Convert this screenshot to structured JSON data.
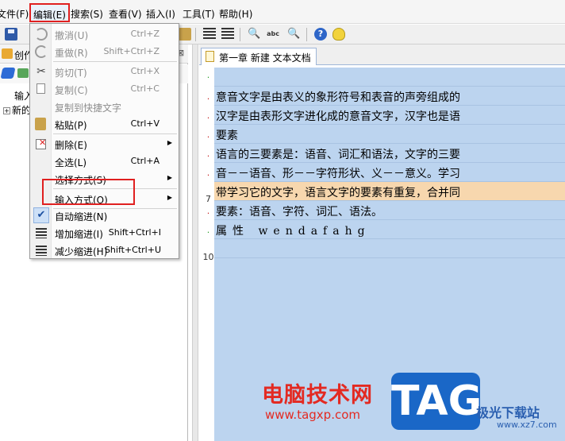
{
  "menubar": {
    "items": [
      {
        "label": "文件(F)"
      },
      {
        "label": "编辑(E)"
      },
      {
        "label": "搜索(S)"
      },
      {
        "label": "查看(V)"
      },
      {
        "label": "插入(I)"
      },
      {
        "label": "工具(T)"
      },
      {
        "label": "帮助(H)"
      }
    ]
  },
  "left_panel": {
    "title": "创作",
    "close_glyph": "⊠",
    "tree": [
      {
        "label": "输入"
      },
      {
        "label": "新的"
      }
    ],
    "expander_glyph": "+"
  },
  "editor": {
    "tab_title": "第一章 新建 文本文档",
    "gutter": [
      {
        "mark": "·",
        "color": "green"
      },
      {
        "mark": "·",
        "color": "red"
      },
      {
        "mark": "·",
        "color": "red"
      },
      {
        "mark": "·",
        "color": "red"
      },
      {
        "mark": "·",
        "color": "red"
      },
      {
        "mark": "·",
        "color": "red"
      },
      {
        "mark": "7",
        "color": "num"
      },
      {
        "mark": "·",
        "color": "red"
      },
      {
        "mark": "·",
        "color": "green"
      },
      {
        "mark": "10",
        "color": "num"
      }
    ],
    "lines": [
      "",
      "意音文字是由表义的象形符号和表音的声旁组成的",
      "汉字是由表形文字进化成的意音文字，汉字也是语",
      "要素",
      "语言的三要素是：语音、词汇和语法，文字的三要",
      "音－－语音、形－－字符形状、义－－意义。学习",
      "带学习它的文字，语言文字的要素有重复，合并同",
      "要素：语音、字符、词汇、语法。",
      "属性 wendafahg",
      ""
    ],
    "current_line_index": 6
  },
  "edit_menu": {
    "items": [
      {
        "label": "撤消(U)",
        "shortcut": "Ctrl+Z",
        "icon": "undo-icon",
        "disabled": true
      },
      {
        "label": "重做(R)",
        "shortcut": "Shift+Ctrl+Z",
        "icon": "redo-icon",
        "disabled": true
      },
      {
        "label": "剪切(T)",
        "shortcut": "Ctrl+X",
        "icon": "scissors-icon",
        "disabled": true
      },
      {
        "label": "复制(C)",
        "shortcut": "Ctrl+C",
        "icon": "copy-icon",
        "disabled": true
      },
      {
        "label": "复制到快捷文字",
        "shortcut": "",
        "icon": "",
        "disabled": true
      },
      {
        "label": "粘贴(P)",
        "shortcut": "Ctrl+V",
        "icon": "paste-icon",
        "disabled": false
      },
      {
        "label": "删除(E)",
        "shortcut": "",
        "icon": "delete-icon",
        "disabled": false,
        "submenu": true
      },
      {
        "label": "全选(L)",
        "shortcut": "Ctrl+A",
        "icon": "",
        "disabled": false
      },
      {
        "label": "选择方式(S)",
        "shortcut": "",
        "icon": "",
        "disabled": false,
        "submenu": true
      },
      {
        "label": "输入方式(O)",
        "shortcut": "",
        "icon": "",
        "disabled": false,
        "submenu": true
      },
      {
        "label": "自动缩进(N)",
        "shortcut": "",
        "icon": "check-icon",
        "disabled": false,
        "checked": true
      },
      {
        "label": "增加缩进(I)",
        "shortcut": "Shift+Ctrl+I",
        "icon": "indent-increase-icon",
        "disabled": false
      },
      {
        "label": "减少缩进(H)",
        "shortcut": "Shift+Ctrl+U",
        "icon": "indent-decrease-icon",
        "disabled": false
      }
    ],
    "submenu_glyph": "▶",
    "check_glyph": "✔"
  },
  "toolbar": {
    "find_glyph": "🔍",
    "abc_label": "abc",
    "help_glyph": "?"
  },
  "watermark": {
    "name": "电脑技术网",
    "url": "www.tagxp.com",
    "tag": "TAG",
    "site": "极光下载站",
    "site_url": "www.xz7.com"
  },
  "colors": {
    "highlight_red": "#e02020",
    "text_area_bg": "#bcd4ef",
    "current_line_bg": "#f7d7ae",
    "tag_blue": "#1a67c7"
  }
}
